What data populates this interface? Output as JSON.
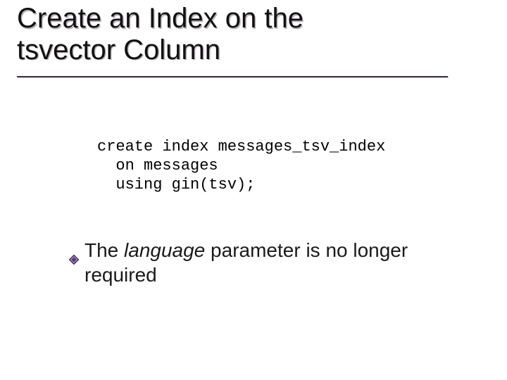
{
  "title": {
    "line1": "Create an Index on the",
    "line2": "tsvector Column"
  },
  "code": {
    "line1": "create index messages_tsv_index",
    "line2": "  on messages",
    "line3": "  using gin(tsv);"
  },
  "bullet": {
    "pre": "The ",
    "italic": "language",
    "post": " parameter is no longer required"
  },
  "colors": {
    "bullet_fill": "#5a3e78",
    "bullet_edge": "#3b2950"
  }
}
